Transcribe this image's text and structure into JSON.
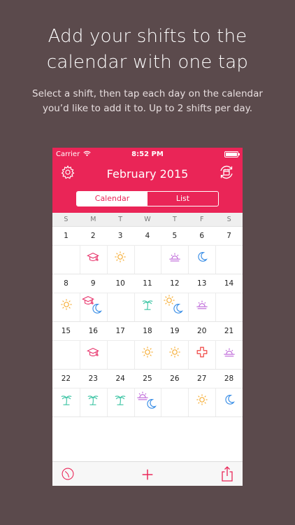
{
  "headline": {
    "line1": "Add your shifts to the",
    "line2": "calendar with one tap"
  },
  "subheadline": {
    "line1": "Select a shift, then tap each day on the calendar",
    "line2": "you’d like to add it to. Up to 2 shifts per day."
  },
  "status_bar": {
    "carrier": "Carrier",
    "time": "8:52 PM"
  },
  "header": {
    "title": "February 2015"
  },
  "segments": [
    {
      "label": "Calendar",
      "active": true
    },
    {
      "label": "List",
      "active": false
    }
  ],
  "weekdays": [
    "S",
    "M",
    "T",
    "W",
    "T",
    "F",
    "S"
  ],
  "weeks": [
    [
      {
        "day": "1",
        "shifts": []
      },
      {
        "day": "2",
        "shifts": [
          "grad-cap-icon"
        ]
      },
      {
        "day": "3",
        "shifts": [
          "sun-icon"
        ]
      },
      {
        "day": "4",
        "shifts": []
      },
      {
        "day": "5",
        "shifts": [
          "sunrise-icon"
        ]
      },
      {
        "day": "6",
        "shifts": [
          "moon-icon"
        ]
      },
      {
        "day": "7",
        "shifts": []
      }
    ],
    [
      {
        "day": "8",
        "shifts": [
          "sun-icon"
        ]
      },
      {
        "day": "9",
        "shifts": [
          "grad-cap-icon",
          "moon-icon"
        ]
      },
      {
        "day": "10",
        "shifts": []
      },
      {
        "day": "11",
        "shifts": [
          "palm-icon"
        ]
      },
      {
        "day": "12",
        "shifts": [
          "sun-icon",
          "moon-icon"
        ]
      },
      {
        "day": "13",
        "shifts": [
          "sunrise-icon"
        ]
      },
      {
        "day": "14",
        "shifts": []
      }
    ],
    [
      {
        "day": "15",
        "shifts": []
      },
      {
        "day": "16",
        "shifts": [
          "grad-cap-icon"
        ]
      },
      {
        "day": "17",
        "shifts": []
      },
      {
        "day": "18",
        "shifts": [
          "sun-icon"
        ]
      },
      {
        "day": "19",
        "shifts": [
          "sun-icon"
        ]
      },
      {
        "day": "20",
        "shifts": [
          "medical-cross-icon"
        ]
      },
      {
        "day": "21",
        "shifts": [
          "sunrise-icon"
        ]
      }
    ],
    [
      {
        "day": "22",
        "shifts": [
          "palm-icon"
        ]
      },
      {
        "day": "23",
        "shifts": [
          "palm-icon"
        ]
      },
      {
        "day": "24",
        "shifts": [
          "palm-icon"
        ]
      },
      {
        "day": "25",
        "shifts": [
          "sunrise-icon",
          "moon-icon"
        ]
      },
      {
        "day": "26",
        "shifts": []
      },
      {
        "day": "27",
        "shifts": [
          "sun-icon"
        ]
      },
      {
        "day": "28",
        "shifts": [
          "moon-icon"
        ]
      }
    ]
  ],
  "colors": {
    "accent": "#ea2557",
    "sun": "#f5a623",
    "moon": "#3a8ee6",
    "sunrise": "#b95bd6",
    "palm": "#33c2a0",
    "grad_cap": "#e8336b",
    "cross": "#f25f5c"
  }
}
